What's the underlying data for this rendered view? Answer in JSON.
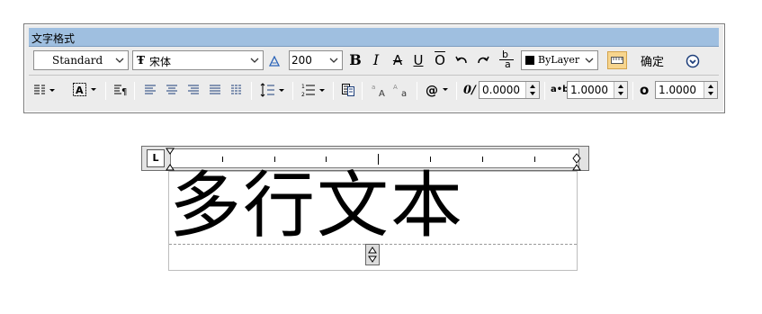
{
  "window": {
    "title": "文字格式"
  },
  "toolbar": {
    "style": {
      "value": "Standard"
    },
    "font": {
      "value": "宋体",
      "prefix_icon": "truetype-font-icon"
    },
    "annotative_icon": "annotative-icon",
    "height": {
      "value": "200"
    },
    "bold_label": "B",
    "italic_label": "I",
    "strike_label": "A",
    "underline_label": "U",
    "overline_label": "O",
    "stack_label_top": "b",
    "stack_label_bottom": "a",
    "color": {
      "value": "ByLayer",
      "swatch": "#000000"
    },
    "ok_label": "确定",
    "options_icon": "chevron-down-circle-icon",
    "oblique_label": "0/",
    "oblique_value": "0.0000",
    "tracking_label": "a•b",
    "tracking_value": "1.0000",
    "width_label": "o",
    "width_value": "1.0000"
  },
  "ruler": {
    "tab_label": "L"
  },
  "editor": {
    "text": "多行文本"
  }
}
